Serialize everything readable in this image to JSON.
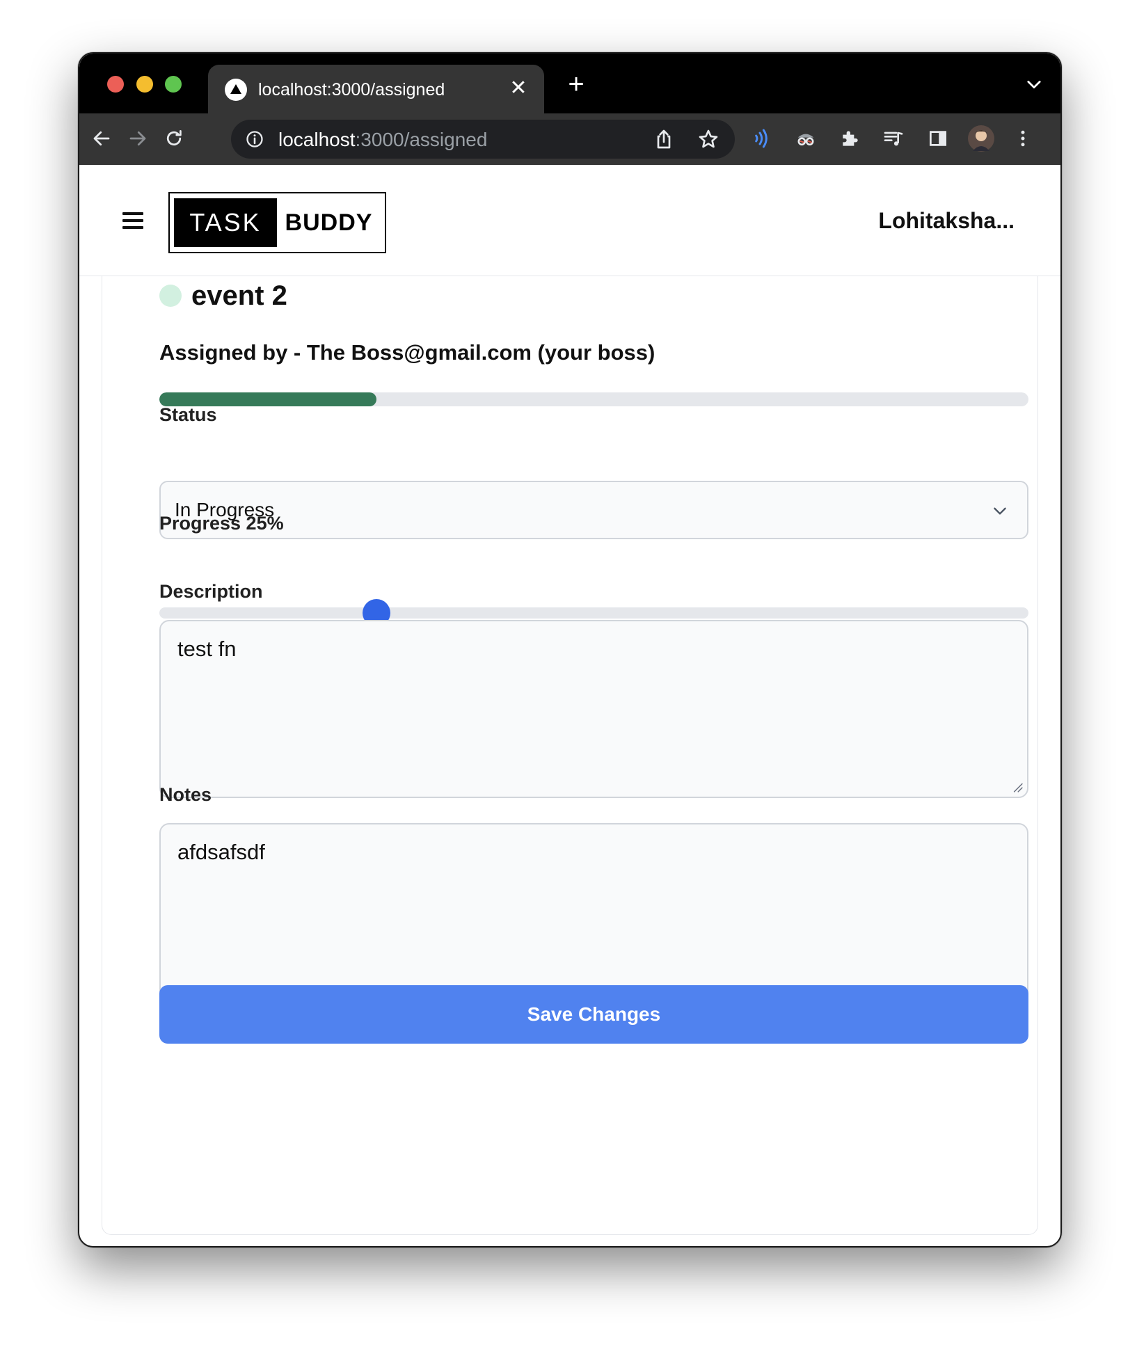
{
  "browser": {
    "tab_title": "localhost:3000/assigned",
    "url_host": "localhost",
    "url_rest": ":3000/assigned"
  },
  "header": {
    "logo_left": "TASK",
    "logo_right": "BUDDY",
    "username": "Lohitaksha..."
  },
  "task": {
    "title": "event 2",
    "status_dot_color": "#d2f0e0",
    "assigned_by": "Assigned by - The Boss@gmail.com (your boss)",
    "progress_fraction": 0.25
  },
  "form": {
    "status_label": "Status",
    "status_value": "In Progress",
    "progress_label": "Progress 25%",
    "description_label": "Description",
    "description_value": "test fn",
    "notes_label": "Notes",
    "notes_value": "afdsafsdf",
    "save_label": "Save Changes"
  },
  "colors": {
    "progress_fill": "#367a59",
    "slider_thumb": "#3265e6",
    "save_button": "#5082ef"
  }
}
